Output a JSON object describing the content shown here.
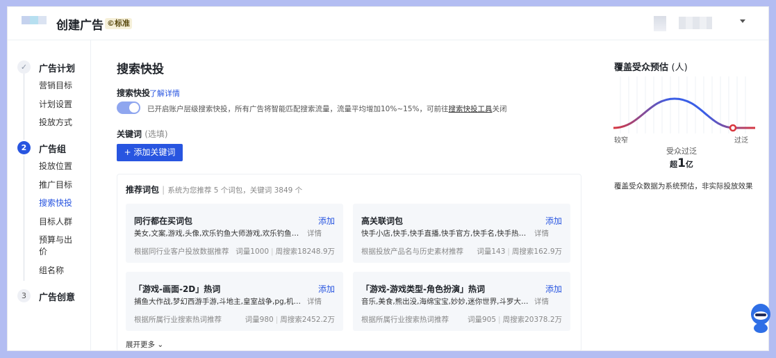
{
  "header": {
    "title": "创建广告",
    "badge": "©标准"
  },
  "nav": {
    "steps": [
      {
        "number": "",
        "title": "广告计划",
        "status": "done",
        "items": [
          "营销目标",
          "计划设置",
          "投放方式"
        ]
      },
      {
        "number": "2",
        "title": "广告组",
        "status": "active",
        "items": [
          "投放位置",
          "推广目标",
          "搜索快投",
          "目标人群",
          "预算与出价",
          "组名称"
        ]
      },
      {
        "number": "3",
        "title": "广告创意",
        "status": "todo",
        "items": []
      }
    ],
    "active_item": "搜索快投"
  },
  "main": {
    "title": "搜索快投",
    "quick": {
      "label": "搜索快投",
      "link": "了解详情",
      "toggle_on": true,
      "desc_prefix": "已开启账户层级搜索快投，所有广告将智能匹配搜索流量，流量平均增加10%~15%，可前往",
      "desc_link": "搜索快投工具",
      "desc_suffix": "关闭"
    },
    "keywords": {
      "label": "关键词",
      "optional": "(选填)",
      "add_button": "+ 添加关键词"
    },
    "recommend": {
      "title": "推荐词包",
      "subtitle": "系统为您推荐 5 个词包，关键词 3849 个",
      "cards": [
        {
          "title": "同行都在买词包",
          "add": "添加",
          "words": "美女,文案,游戏,头像,欢乐钓鱼大师游戏,欢乐钓鱼大师,王者...",
          "detail": "详情",
          "source": "根据同行业客户投放数据推荐",
          "count": "词量1000",
          "search": "周搜索18248.9万"
        },
        {
          "title": "高关联词包",
          "add": "添加",
          "words": "快手小店,快手,快手直播,快手官方,快手名,快手热门,官方快...",
          "detail": "详情",
          "source": "根据投放产品名与历史素材推荐",
          "count": "词量143",
          "search": "周搜索162.9万"
        },
        {
          "title": "「游戏-画面-2D」热词",
          "add": "添加",
          "words": "捕鱼大作战,梦幻西游手游,斗地主,皇室战争,pg,机甲斗兽场,...",
          "detail": "详情",
          "source": "根据所属行业搜索热词推荐",
          "count": "词量980",
          "search": "周搜索2452.2万"
        },
        {
          "title": "「游戏-游戏类型-角色扮演」热词",
          "add": "添加",
          "words": "音乐,美食,熊出没,海绵宝宝,妙妙,迷你世界,斗罗大陆,马桶人...",
          "detail": "详情",
          "source": "根据所属行业搜索热词推荐",
          "count": "词量905",
          "search": "周搜索20378.2万"
        }
      ],
      "expand": "展开更多"
    }
  },
  "coverage": {
    "title": "覆盖受众预估",
    "unit": "(人)",
    "narrow": "较窄",
    "broad": "过泛",
    "level": "受众过泛",
    "count_prefix": "超",
    "count_num": "1",
    "count_unit": "亿",
    "note": "覆盖受众数据为系统预估，非实际投放效果"
  },
  "colors": {
    "accent": "#2855e0",
    "curve_red": "#d9363e",
    "background": "#b3bdf2"
  },
  "icons": {
    "check": "check-icon",
    "chevron": "chevron-down-icon",
    "assistant": "assistant-bot-icon"
  }
}
